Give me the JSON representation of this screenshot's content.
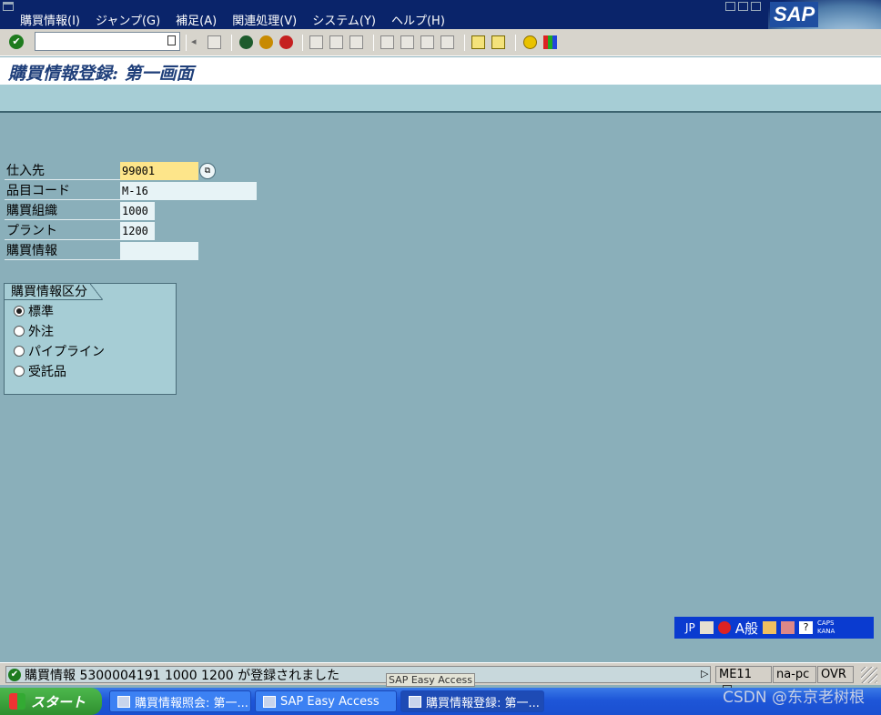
{
  "menu": {
    "items": [
      "購買情報(I)",
      "ジャンプ(G)",
      "補足(A)",
      "関連処理(V)",
      "システム(Y)",
      "ヘルプ(H)"
    ]
  },
  "brand": {
    "logo_text": "SAP"
  },
  "toolbar": {
    "command_field_value": ""
  },
  "screen": {
    "title": "購買情報登録: 第一画面"
  },
  "fields": {
    "vendor": {
      "label": "仕入先",
      "value": "99001"
    },
    "material": {
      "label": "品目コード",
      "value": "M-16"
    },
    "purch_org": {
      "label": "購買組織",
      "value": "1000"
    },
    "plant": {
      "label": "プラント",
      "value": "1200"
    },
    "info_record": {
      "label": "購買情報",
      "value": ""
    }
  },
  "category_group": {
    "title": "購買情報区分",
    "options": [
      {
        "label": "標準",
        "selected": true
      },
      {
        "label": "外注",
        "selected": false
      },
      {
        "label": "パイプライン",
        "selected": false
      },
      {
        "label": "受託品",
        "selected": false
      }
    ]
  },
  "ime": {
    "lang": "JP",
    "mode": "A般",
    "caps": "CAPS",
    "kana": "KANA"
  },
  "status": {
    "message": "購買情報 5300004191 1000  1200 が登録されました",
    "transaction": "ME11",
    "server": "na-pc",
    "mode": "OVR"
  },
  "tooltip": "SAP Easy Access",
  "taskbar": {
    "start_label": "スタート",
    "tasks": [
      {
        "label": "購買情報照会: 第一...",
        "active": false
      },
      {
        "label": "SAP Easy Access",
        "active": false
      },
      {
        "label": "購買情報登録: 第一...",
        "active": true
      }
    ],
    "watermark": "CSDN @东京老树根"
  },
  "colors": {
    "menubar": "#0a246a",
    "background": "#8aafba",
    "panel": "#a6cdd5",
    "title": "#1f3f7a",
    "focused_field": "#fde58a"
  }
}
